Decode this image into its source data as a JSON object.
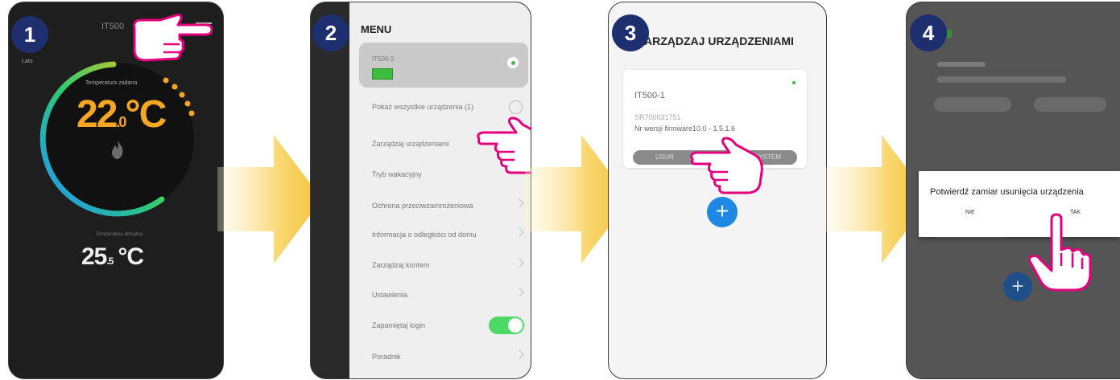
{
  "steps": [
    "1",
    "2",
    "3",
    "4"
  ],
  "screen1": {
    "device_name": "IT500",
    "corner_label": "Lato",
    "dial_label": "Temperatura zadana",
    "set_temp_whole": "22",
    "set_temp_dec": ".0",
    "set_temp_unit": "°C",
    "current_label": "Temperatura aktualna",
    "current_temp_whole": "25",
    "current_temp_dec": ".5",
    "current_temp_unit": "°C"
  },
  "screen2": {
    "title": "MENU",
    "device_name": "IT500-2",
    "items": [
      "Pokaż wszystkie urządzenia (1)",
      "Zarządzaj urządzeniami",
      "Tryb wakacyjny",
      "Ochrona przeciwzamrożeniowa",
      "Informacja o odległości od domu",
      "Zarządzaj kontem",
      "Ustawienia",
      "Zapamiętaj login",
      "Poradnik"
    ]
  },
  "screen3": {
    "title": "ZARZĄDZAJ URZĄDZENIAMI",
    "title_visible": "ARZĄDZAJ URZĄDZENIAMI",
    "device_name": "IT500-1",
    "serial": "SR700031751",
    "firmware": "Nr wersji firmware10.0 - 1.5.1.6",
    "remove_label": "USUŃ",
    "system_label": "SYSTEM",
    "add_label": "+"
  },
  "screen4": {
    "dialog_text": "Potwierdź zamiar usunięcia urządzenia",
    "no_label": "NIE",
    "yes_label": "TAK",
    "add_label": "+"
  },
  "colors": {
    "badge": "#1d2f6f",
    "arrow": "#f7c948",
    "hand": "#e6007e",
    "accent_orange": "#f5a623",
    "green": "#4cd964",
    "blue_button": "#1e88e5"
  }
}
